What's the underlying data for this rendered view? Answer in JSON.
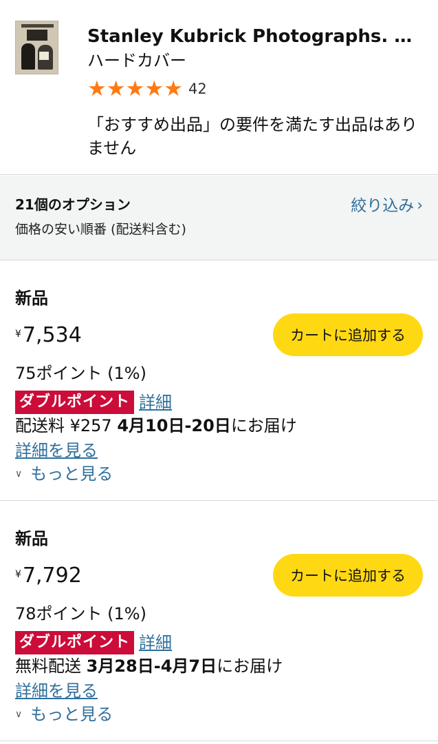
{
  "product": {
    "title": "Stanley Kubrick Photographs. …",
    "format": "ハードカバー",
    "rating_stars": 5,
    "rating_count": "42",
    "star_color": "#ff7a13",
    "note": "「おすすめ出品」の要件を満たす出品はありません"
  },
  "options": {
    "count_title": "21個のオプション",
    "sort_label": "価格の安い順番 (配送料含む)",
    "filter_label": "絞り込み",
    "filter_icon": "chevron-right-icon",
    "link_color": "#2f6f9c"
  },
  "offers": [
    {
      "condition": "新品",
      "currency": "¥",
      "price": "7,534",
      "cart_label": "カートに追加する",
      "points": "75ポイント (1%)",
      "badge": "ダブルポイント",
      "badge_link": "詳細",
      "ship_prefix": "配送料 ¥257 ",
      "ship_date": "4月10日-20日",
      "ship_suffix": "にお届け",
      "see_details": "詳細を見る",
      "see_more": "もっと見る"
    },
    {
      "condition": "新品",
      "currency": "¥",
      "price": "7,792",
      "cart_label": "カートに追加する",
      "points": "78ポイント (1%)",
      "badge": "ダブルポイント",
      "badge_link": "詳細",
      "ship_prefix": "無料配送 ",
      "ship_date": "3月28日-4月7日",
      "ship_suffix": "にお届け",
      "see_details": "詳細を見る",
      "see_more": "もっと見る"
    }
  ],
  "colors": {
    "cart_button": "#ffd814",
    "badge": "#cc0c39",
    "options_bg": "#f3f4f4"
  }
}
